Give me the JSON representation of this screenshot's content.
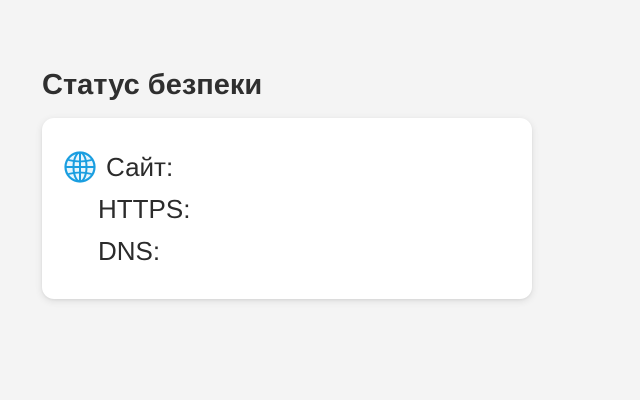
{
  "security": {
    "title": "Статус безпеки",
    "site_label": "Сайт:",
    "https_label": "HTTPS:",
    "dns_label": "DNS:",
    "site_icon": "globe-icon",
    "icon_color": "#1a9ee0"
  }
}
